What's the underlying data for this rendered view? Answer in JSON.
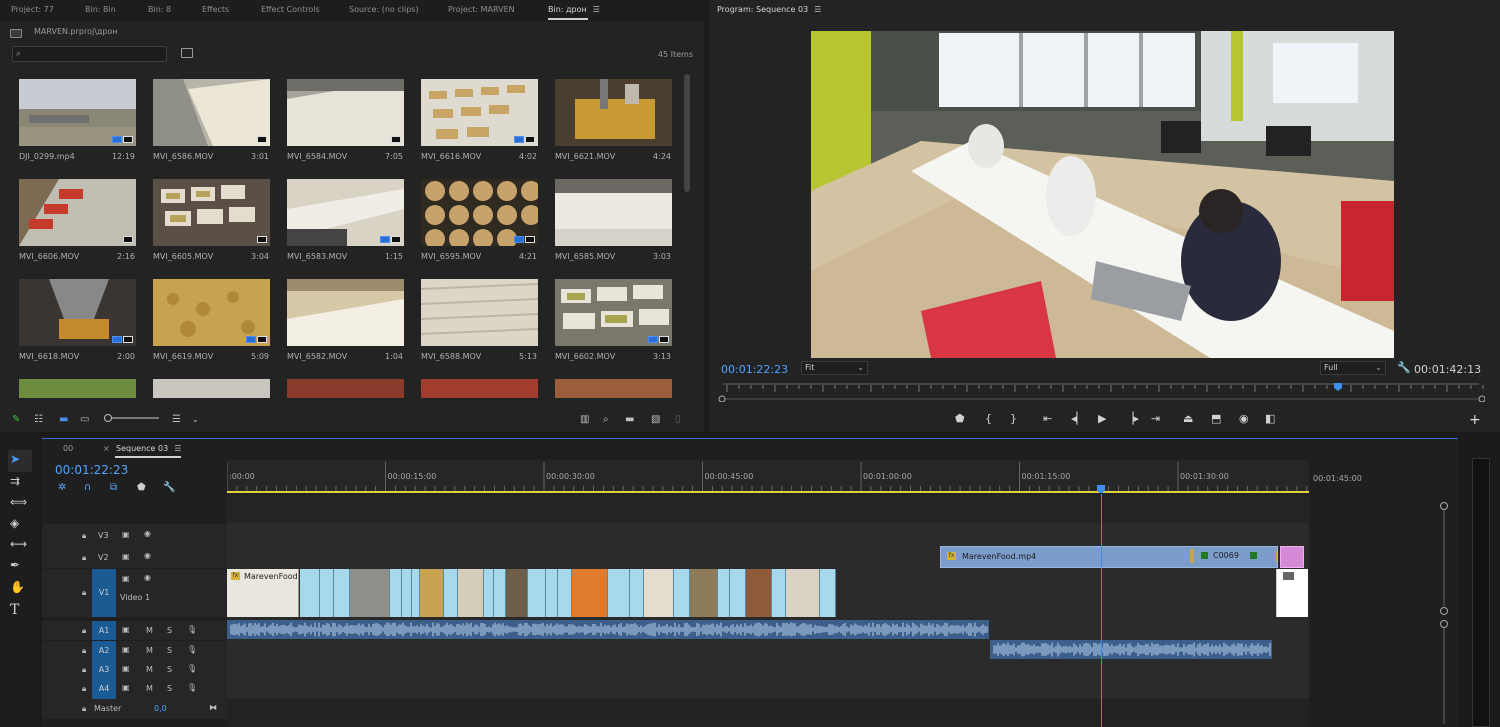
{
  "tabs": [
    "Project: 77",
    "Bin: Bin",
    "Bin: 8",
    "Effects",
    "Effect Controls",
    "Source: (no clips)",
    "Project: MARVEN",
    "Bin: дрон"
  ],
  "project": {
    "path": "MARVEN.prproj\\дрон",
    "item_count": "45 Items"
  },
  "clips": [
    {
      "name": "DJI_0299.mp4",
      "duration": "12:19"
    },
    {
      "name": "MVI_6586.MOV",
      "duration": "3:01"
    },
    {
      "name": "MVI_6584.MOV",
      "duration": "7:05"
    },
    {
      "name": "MVI_6616.MOV",
      "duration": "4:02"
    },
    {
      "name": "MVI_6621.MOV",
      "duration": "4:24"
    },
    {
      "name": "MVI_6606.MOV",
      "duration": "2:16"
    },
    {
      "name": "MVI_6605.MOV",
      "duration": "3:04"
    },
    {
      "name": "MVI_6583.MOV",
      "duration": "1:15"
    },
    {
      "name": "MVI_6595.MOV",
      "duration": "4:21"
    },
    {
      "name": "MVI_6585.MOV",
      "duration": "3:03"
    },
    {
      "name": "MVI_6618.MOV",
      "duration": "2:00"
    },
    {
      "name": "MVI_6619.MOV",
      "duration": "5:09"
    },
    {
      "name": "MVI_6582.MOV",
      "duration": "1:04"
    },
    {
      "name": "MVI_6588.MOV",
      "duration": "5:13"
    },
    {
      "name": "MVI_6602.MOV",
      "duration": "3:13"
    }
  ],
  "program": {
    "title": "Program: Sequence 03",
    "timecode_current": "00:01:22:23",
    "timecode_duration": "00:01:42:13",
    "zoom": "Fit",
    "resolution": "Full"
  },
  "timeline": {
    "tabs": [
      "00",
      "Sequence 03"
    ],
    "timecode": "00:01:22:23",
    "ruler_labels": [
      ":00:00",
      "00:00:15:00",
      "00:00:30:00",
      "00:00:45:00",
      "00:01:00:00",
      "00:01:15:00",
      "00:01:30:00",
      "00:01:45:00"
    ],
    "tracks": [
      {
        "label": "V3"
      },
      {
        "label": "V2"
      },
      {
        "label": "V1",
        "name": "Video 1"
      },
      {
        "label": "A1"
      },
      {
        "label": "A2"
      },
      {
        "label": "A3"
      },
      {
        "label": "A4"
      }
    ],
    "mute_label": "M",
    "solo_label": "S",
    "master_label": "Master",
    "master_value": "0,0",
    "clips": {
      "v1_first": "MarevenFood.",
      "v2_main": "MarevenFood.mp4",
      "v2_second": "C0069"
    }
  }
}
